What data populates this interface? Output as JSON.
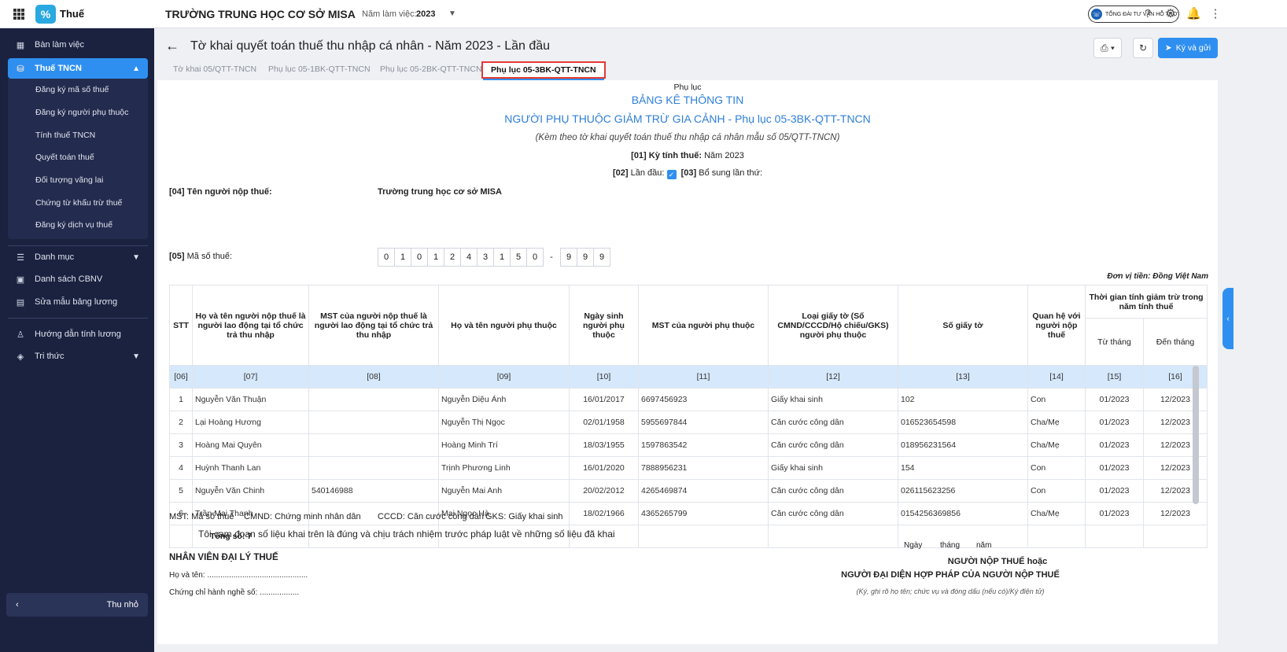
{
  "app": {
    "name": "Thuế",
    "org": "TRƯỜNG TRUNG HỌC CƠ SỞ MISA",
    "year_label": "Năm làm việc:",
    "year": "2023",
    "hotline": "TỔNG ĐÀI TƯ VẤN HỖ TRỢ"
  },
  "sidebar": {
    "items": [
      {
        "label": "Bàn làm việc"
      },
      {
        "label": "Thuế TNCN"
      },
      {
        "label": "Danh mục"
      },
      {
        "label": "Danh sách CBNV"
      },
      {
        "label": "Sửa mẫu bảng lương"
      },
      {
        "label": "Hướng dẫn tính lương"
      },
      {
        "label": "Tri thức"
      }
    ],
    "sub_items": [
      "Đăng ký mã số thuế",
      "Đăng ký người phụ thuộc",
      "Tính thuế TNCN",
      "Quyết toán thuế",
      "Đối tượng vãng lai",
      "Chứng từ khấu trừ thuế",
      "Đăng ký dịch vụ thuế"
    ],
    "collapse_label": "Thu nhỏ"
  },
  "header": {
    "title": "Tờ khai quyết toán thuế thu nhập cá nhân - Năm 2023 - Lần đầu",
    "sign_label": "Ký và gửi"
  },
  "tabs": [
    "Tờ khai 05/QTT-TNCN",
    "Phụ lục 05-1BK-QTT-TNCN",
    "Phụ lục 05-2BK-QTT-TNCN",
    "Phụ lục 05-3BK-QTT-TNCN"
  ],
  "doc": {
    "pre": "Phụ lục",
    "title1": "BẢNG KÊ THÔNG TIN",
    "title2": "NGƯỜI PHỤ THUỘC GIẢM TRỪ GIA CẢNH - Phụ lục 05-3BK-QTT-TNCN",
    "subtitle": "(Kèm theo tờ khai quyết toán thuế thu nhập cá nhân mẫu số 05/QTT-TNCN)",
    "period_label": "[01] Kỳ tính thuế:",
    "period_value": "Năm 2023",
    "first_label": "[02]",
    "first_text": "Lần đầu:",
    "supp_label": "[03]",
    "supp_text": "Bổ sung lần thứ:",
    "taxpayer_label": "[04] Tên người nộp thuế:",
    "taxpayer_value": "Trường trung học cơ sở MISA",
    "taxcode_label": "[05]",
    "taxcode_text": "Mã số thuế:",
    "taxcode_digits": [
      "0",
      "1",
      "0",
      "1",
      "2",
      "4",
      "3",
      "1",
      "5",
      "0"
    ],
    "taxcode_dash": "-",
    "taxcode_branch": [
      "9",
      "9",
      "9"
    ],
    "currency": "Đơn vị tiền: Đồng Việt Nam",
    "columns": {
      "stt": "STT",
      "name": "Họ và tên người nộp thuế là người lao động tại tổ chức trả thu nhập",
      "mst": "MST của người nộp thuế là người lao động tại tổ chức trả thu nhập",
      "dep_name": "Họ và tên người phụ thuộc",
      "dob": "Ngày sinh người phụ thuộc",
      "dep_mst": "MST của người phụ thuộc",
      "doc_type": "Loại giấy tờ (Số CMND/CCCD/Hộ chiếu/GKS) người phụ thuộc",
      "doc_no": "Số giấy tờ",
      "relation": "Quan hệ với người nộp thuế",
      "period": "Thời gian tính giảm trừ trong năm tính thuế",
      "from": "Từ tháng",
      "to": "Đến tháng"
    },
    "codes": [
      "[06]",
      "[07]",
      "[08]",
      "[09]",
      "[10]",
      "[11]",
      "[12]",
      "[13]",
      "[14]",
      "[15]",
      "[16]"
    ],
    "rows": [
      {
        "stt": "1",
        "name": "Nguyễn Văn Thuận",
        "mst": "",
        "dep": "Nguyễn Diệu Ánh",
        "dob": "16/01/2017",
        "dep_mst": "6697456923",
        "doc_type": "Giấy khai sinh",
        "doc_no": "102",
        "rel": "Con",
        "from": "01/2023",
        "to": "12/2023"
      },
      {
        "stt": "2",
        "name": "Lại Hoàng Hương",
        "mst": "",
        "dep": "Nguyễn Thị Ngọc",
        "dob": "02/01/1958",
        "dep_mst": "5955697844",
        "doc_type": "Căn cước công dân",
        "doc_no": "016523654598",
        "rel": "Cha/Mẹ",
        "from": "01/2023",
        "to": "12/2023"
      },
      {
        "stt": "3",
        "name": "Hoàng Mai Quyên",
        "mst": "",
        "dep": "Hoàng Minh Trí",
        "dob": "18/03/1955",
        "dep_mst": "1597863542",
        "doc_type": "Căn cước công dân",
        "doc_no": "018956231564",
        "rel": "Cha/Mẹ",
        "from": "01/2023",
        "to": "12/2023"
      },
      {
        "stt": "4",
        "name": "Huỳnh Thanh Lan",
        "mst": "",
        "dep": "Trịnh Phương Linh",
        "dob": "16/01/2020",
        "dep_mst": "7888956231",
        "doc_type": "Giấy khai sinh",
        "doc_no": "154",
        "rel": "Con",
        "from": "01/2023",
        "to": "12/2023"
      },
      {
        "stt": "5",
        "name": "Nguyễn Văn Chinh",
        "mst": "540146988",
        "dep": "Nguyễn Mai Anh",
        "dob": "20/02/2012",
        "dep_mst": "4265469874",
        "doc_type": "Căn cước công dân",
        "doc_no": "026115623256",
        "rel": "Con",
        "from": "01/2023",
        "to": "12/2023"
      },
      {
        "stt": "6",
        "name": "Trần Mai Thanh",
        "mst": "",
        "dep": "Mai Ngọc Hà",
        "dob": "18/02/1966",
        "dep_mst": "4365265799",
        "doc_type": "Căn cước công dân",
        "doc_no": "0154256369856",
        "rel": "Cha/Mẹ",
        "from": "01/2023",
        "to": "12/2023"
      }
    ],
    "total": "Tổng số: 7",
    "legend": [
      "MST: Mã số thuế",
      "CMND: Chứng minh nhân dân",
      "CCCD: Căn cước công dân",
      "GKS: Giấy khai sinh"
    ],
    "commit": "Tôi cam đoan số liệu khai trên là đúng và chịu trách nhiệm trước pháp luật về những số liệu đã khai",
    "agent_title": "NHÂN VIÊN ĐẠI LÝ THUẾ",
    "agent_name": "Họ và tên: ..............................................",
    "agent_cert": "Chứng chỉ hành nghề số: ..................",
    "date_day": "Ngày",
    "date_month": "tháng",
    "date_year": "năm",
    "signer1": "NGƯỜI NỘP THUẾ hoặc",
    "signer2": "NGƯỜI ĐẠI DIỆN HỢP PHÁP CỦA NGƯỜI NỘP THUẾ",
    "signer_note": "(Ký, ghi rõ họ tên; chức vụ và đóng dấu (nếu có)/Ký điện tử)"
  },
  "colors": {
    "sidebar": "#1b2240",
    "accent": "#2f8ff0",
    "highlight": "#e53935"
  }
}
